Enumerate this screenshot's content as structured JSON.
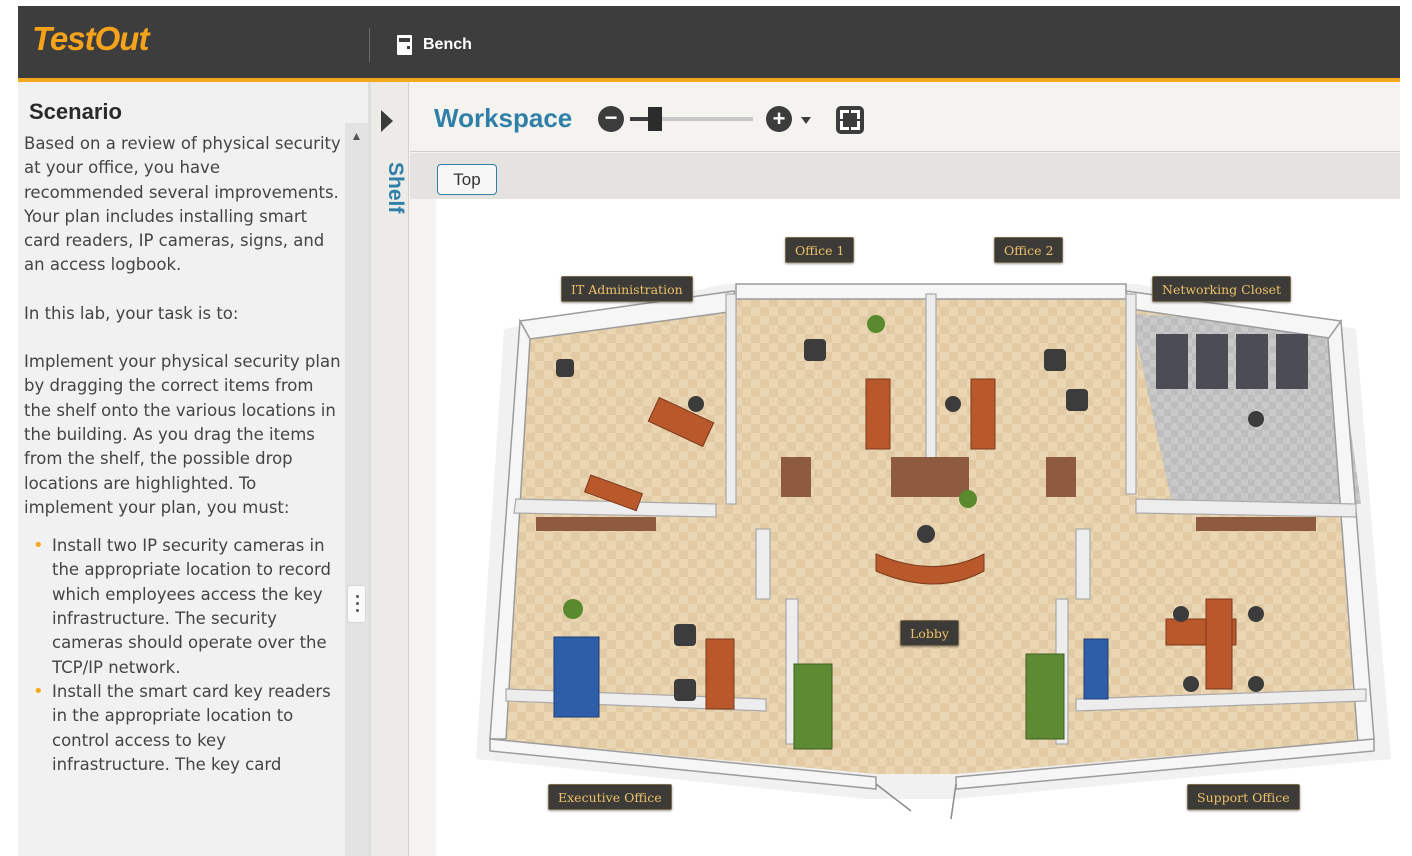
{
  "header": {
    "logo": "TestOut",
    "bench_label": "Bench"
  },
  "scenario": {
    "title": "Scenario",
    "paragraphs": [
      "Based on a review of physical security at your office, you have recommended several improvements. Your plan includes installing smart card readers, IP cameras, signs, and an access logbook.",
      "In this lab, your task is to:",
      "Implement your physical security plan by dragging the correct items from the shelf onto the various locations in the building. As you drag the items from the shelf, the possible drop locations are highlighted. To implement your plan, you must:"
    ],
    "bullets": [
      "Install two IP security cameras in the appropriate location to record which employees access the key infrastructure. The security cameras should operate over the TCP/IP network.",
      "Install the smart card key readers in the appropriate location to control access to key infrastructure. The key card"
    ]
  },
  "shelf": {
    "label": "Shelf"
  },
  "workspace": {
    "title": "Workspace",
    "zoom_level": 0.2,
    "top_button": "Top"
  },
  "floorplan": {
    "rooms": [
      "Office 1",
      "Office 2",
      "IT Administration",
      "Networking Closet",
      "Lobby",
      "Executive Office",
      "Support Office"
    ]
  },
  "colors": {
    "brand_orange": "#f5a31a",
    "accent_blue": "#2f7fa8",
    "header_dark": "#3d3d3d"
  }
}
